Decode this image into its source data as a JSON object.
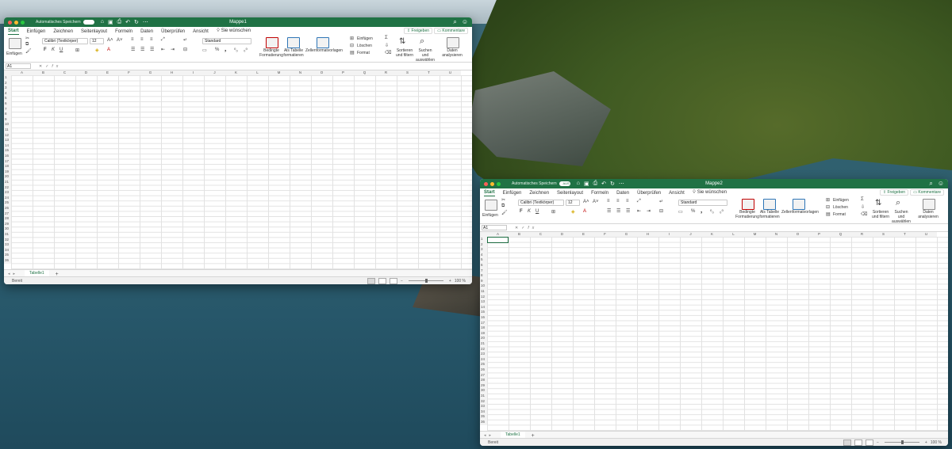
{
  "windows": [
    {
      "autosave_label": "Automatisches Speichern",
      "autosave_state": "",
      "title": "Mappe1",
      "ribbon_tabs": [
        "Start",
        "Einfügen",
        "Zeichnen",
        "Seitenlayout",
        "Formeln",
        "Daten",
        "Überprüfen",
        "Ansicht"
      ],
      "tell_me": "Sie wünschen",
      "share": "Freigeben",
      "comments": "Kommentare",
      "paste": "Einfügen",
      "font_name": "Calibri (Textkörper)",
      "font_size": "12",
      "number_format": "Standard",
      "cond_format": [
        "Bedingte",
        "Formatierung"
      ],
      "as_table": [
        "Als Tabelle",
        "formatieren"
      ],
      "cell_styles": "Zellenformatvorlagen",
      "insert": "Einfügen",
      "delete": "Löschen",
      "format": "Format",
      "sort_filter": [
        "Sortieren",
        "und filtern"
      ],
      "find_select": [
        "Suchen und",
        "auswählen"
      ],
      "analyze": [
        "Daten",
        "analysieren"
      ],
      "name_box": "A1",
      "fx": "fx",
      "columns": [
        "A",
        "B",
        "C",
        "D",
        "E",
        "F",
        "G",
        "H",
        "I",
        "J",
        "K",
        "L",
        "M",
        "N",
        "O",
        "P",
        "Q",
        "R",
        "S",
        "T",
        "U"
      ],
      "rows": 36,
      "sheet": "Tabelle1",
      "status": "Bereit",
      "zoom": "100 %",
      "active": false
    },
    {
      "autosave_label": "Automatisches Speichern",
      "autosave_state": "AUS",
      "title": "Mappe2",
      "ribbon_tabs": [
        "Start",
        "Einfügen",
        "Zeichnen",
        "Seitenlayout",
        "Formeln",
        "Daten",
        "Überprüfen",
        "Ansicht"
      ],
      "tell_me": "Sie wünschen",
      "share": "Freigeben",
      "comments": "Kommentare",
      "paste": "Einfügen",
      "font_name": "Calibri (Textkörper)",
      "font_size": "12",
      "number_format": "Standard",
      "cond_format": [
        "Bedingte",
        "Formatierung"
      ],
      "as_table": [
        "Als Tabelle",
        "formatieren"
      ],
      "cell_styles": "Zellenformatvorlagen",
      "insert": "Einfügen",
      "delete": "Löschen",
      "format": "Format",
      "sort_filter": [
        "Sortieren",
        "und filtern"
      ],
      "find_select": [
        "Suchen und",
        "auswählen"
      ],
      "analyze": [
        "Daten",
        "analysieren"
      ],
      "name_box": "A1",
      "fx": "fx",
      "columns": [
        "A",
        "B",
        "C",
        "D",
        "E",
        "F",
        "G",
        "H",
        "I",
        "J",
        "K",
        "L",
        "M",
        "N",
        "O",
        "P",
        "Q",
        "R",
        "S",
        "T",
        "U"
      ],
      "rows": 36,
      "sheet": "Tabelle1",
      "status": "Bereit",
      "zoom": "100 %",
      "active": true
    }
  ],
  "colors": {
    "excel_green": "#207245",
    "grid_line": "#e2e2e2"
  }
}
